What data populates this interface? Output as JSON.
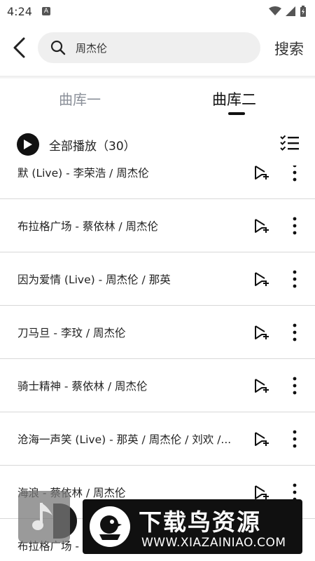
{
  "status_bar": {
    "time": "4:24",
    "badge": "A"
  },
  "search": {
    "query": "周杰伦",
    "button_label": "搜索"
  },
  "tabs": [
    {
      "label": "曲库一",
      "active": false
    },
    {
      "label": "曲库二",
      "active": true
    }
  ],
  "play_all": {
    "label": "全部播放（30）"
  },
  "songs": [
    {
      "title": "默 (Live) - 李荣浩 / 周杰伦"
    },
    {
      "title": "布拉格广场 - 蔡依林 / 周杰伦"
    },
    {
      "title": "因为爱情 (Live) - 周杰伦 / 那英"
    },
    {
      "title": "刀马旦 - 李玟 / 周杰伦"
    },
    {
      "title": "骑士精神 - 蔡依林 / 周杰伦"
    },
    {
      "title": "沧海一声笑 (Live) - 那英 / 周杰伦 / 刘欢 /..."
    },
    {
      "title": "海浪 - 蔡依林 / 周杰伦"
    },
    {
      "title": "布拉格广场 - "
    }
  ],
  "watermark": {
    "title": "下载鸟资源",
    "url": "WWW.XIAZAINIAO.COM"
  },
  "colors": {
    "accent": "#111111",
    "inactive_tab": "#8a8f98",
    "search_bg": "#efefef",
    "divider": "#d8d8d8"
  }
}
